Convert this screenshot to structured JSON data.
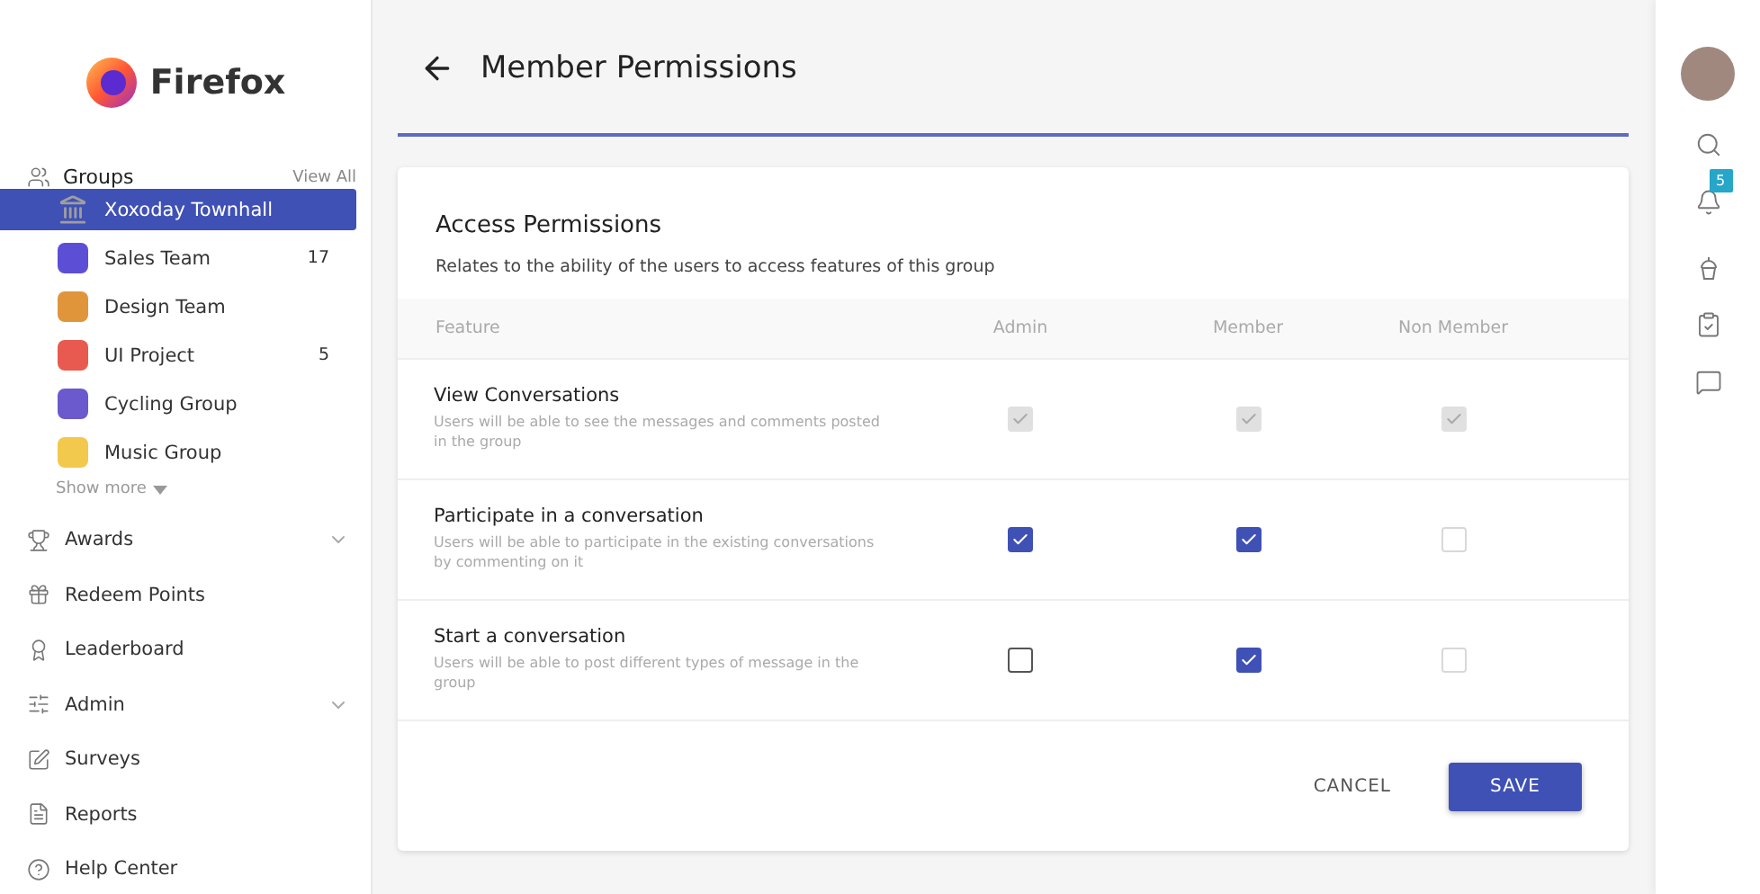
{
  "brand": {
    "name": "Firefox"
  },
  "sidebar": {
    "groups_heading": "Groups",
    "view_all": "View All",
    "groups": [
      {
        "label": "Xoxoday Townhall",
        "selected": true,
        "color": "#9e9e9e"
      },
      {
        "label": "Sales Team",
        "count": "17",
        "selected": false,
        "color": "#5c4fd6"
      },
      {
        "label": "Design Team",
        "selected": false,
        "color": "#e0953a"
      },
      {
        "label": "UI Project",
        "count": "5",
        "selected": false,
        "color": "#e85a4f"
      },
      {
        "label": "Cycling Group",
        "selected": false,
        "color": "#6a5acd"
      },
      {
        "label": "Music Group",
        "selected": false,
        "color": "#f2c94c"
      }
    ],
    "show_more": "Show more",
    "items": [
      {
        "label": "Awards",
        "kind": "expandable"
      },
      {
        "label": "Redeem Points",
        "kind": "plain"
      },
      {
        "label": "Leaderboard",
        "kind": "plain"
      },
      {
        "label": "Admin",
        "kind": "expandable"
      },
      {
        "label": "Surveys",
        "kind": "plain"
      },
      {
        "label": "Reports",
        "kind": "plain"
      },
      {
        "label": "Help Center",
        "kind": "plain"
      }
    ]
  },
  "page": {
    "title": "Member Permissions"
  },
  "card": {
    "title": "Access Permissions",
    "subtitle": "Relates to the ability of the users to access features of this group",
    "columns": [
      "Feature",
      "Admin",
      "Member",
      "Non Member"
    ],
    "rows": [
      {
        "name": "View Conversations",
        "description": "Users will be able to see the messages and comments posted in the group",
        "cells": [
          {
            "checked": true,
            "disabled": true
          },
          {
            "checked": true,
            "disabled": true
          },
          {
            "checked": true,
            "disabled": true
          }
        ]
      },
      {
        "name": "Participate in a conversation",
        "description": "Users will be able to participate in the existing conversations by commenting on it",
        "cells": [
          {
            "checked": true,
            "disabled": false
          },
          {
            "checked": true,
            "disabled": false
          },
          {
            "checked": false,
            "disabled": true
          }
        ]
      },
      {
        "name": "Start a conversation",
        "description": "Users will be able to post different types of message in the group",
        "cells": [
          {
            "checked": false,
            "disabled": false
          },
          {
            "checked": true,
            "disabled": false
          },
          {
            "checked": false,
            "disabled": true
          }
        ]
      }
    ],
    "buttons": [
      "CANCEL",
      "SAVE"
    ]
  },
  "rail": {
    "notification_count": "5"
  }
}
